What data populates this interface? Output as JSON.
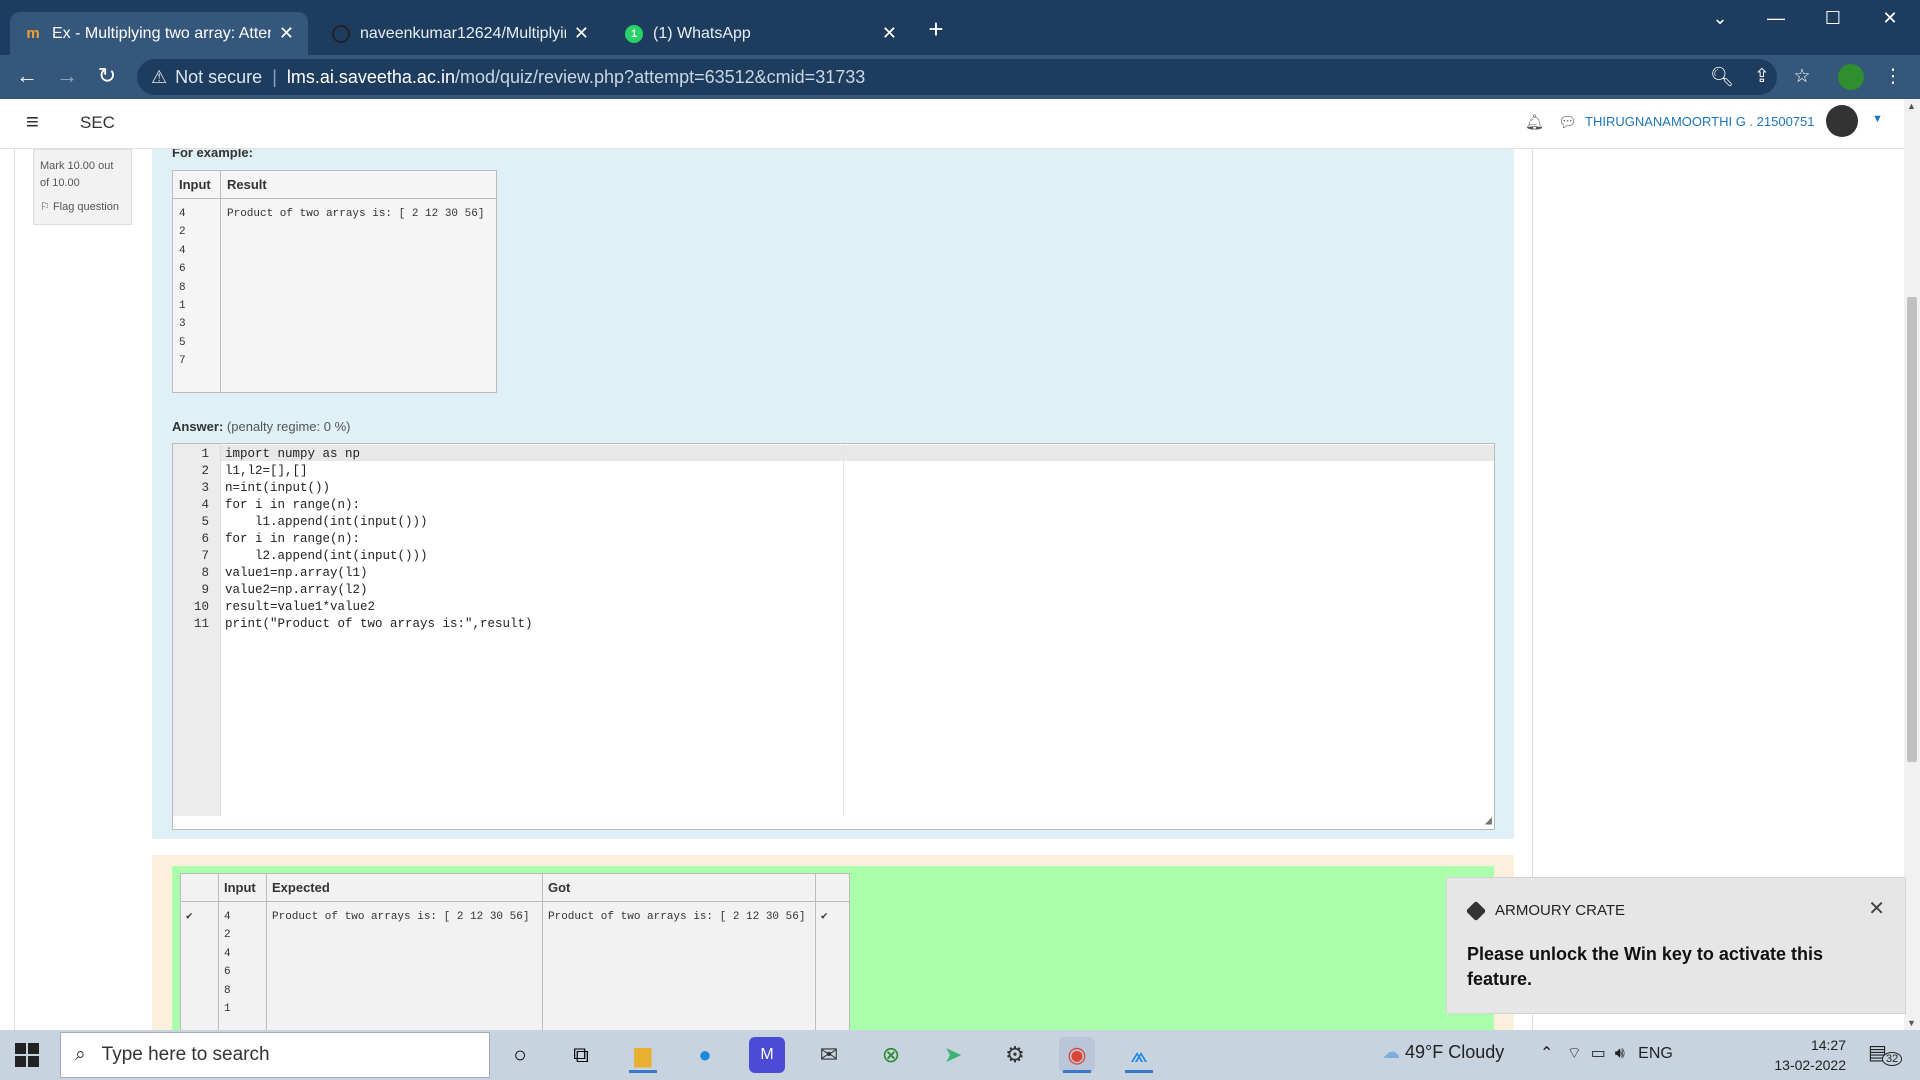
{
  "browser": {
    "tabs": [
      {
        "title": "Ex - Multiplying two array: Attem",
        "active": true
      },
      {
        "title": "naveenkumar12624/Multiplying-",
        "active": false
      },
      {
        "title": "(1) WhatsApp",
        "active": false
      }
    ],
    "new_tab": "+",
    "security": "Not secure",
    "url_host": "lms.ai.saveetha.ac.in",
    "url_path": "/mod/quiz/review.php?attempt=63512&cmid=31733"
  },
  "site": {
    "name": "SEC",
    "user": "THIRUGNANAMOORTHI G . 21500751"
  },
  "question_info": {
    "mark": "Mark 10.00 out of 10.00",
    "flag": "Flag question"
  },
  "example": {
    "heading": "For example:",
    "col_input": "Input",
    "col_result": "Result",
    "input": "4\n2\n4\n6\n8\n1\n3\n5\n7",
    "result": "Product of two arrays is: [ 2 12 30 56]"
  },
  "answer": {
    "label": "Answer:",
    "penalty": "(penalty regime: 0 %)",
    "lines": [
      "import numpy as np",
      "l1,l2=[],[]",
      "n=int(input())",
      "for i in range(n):",
      "    l1.append(int(input()))",
      "for i in range(n):",
      "    l2.append(int(input()))",
      "value1=np.array(l1)",
      "value2=np.array(l2)",
      "result=value1*value2",
      "print(\"Product of two arrays is:\",result)"
    ]
  },
  "results": {
    "col_input": "Input",
    "col_expected": "Expected",
    "col_got": "Got",
    "input": "4\n2\n4\n6\n8\n1",
    "expected": "Product of two arrays is: [ 2 12 30 56]",
    "got": "Product of two arrays is: [ 2 12 30 56]"
  },
  "toast": {
    "app": "ARMOURY CRATE",
    "message": "Please unlock the Win key to activate this feature."
  },
  "taskbar": {
    "search_placeholder": "Type here to search",
    "weather": "49°F  Cloudy",
    "lang": "ENG",
    "time": "14:27",
    "date": "13-02-2022",
    "notifications": "32"
  }
}
